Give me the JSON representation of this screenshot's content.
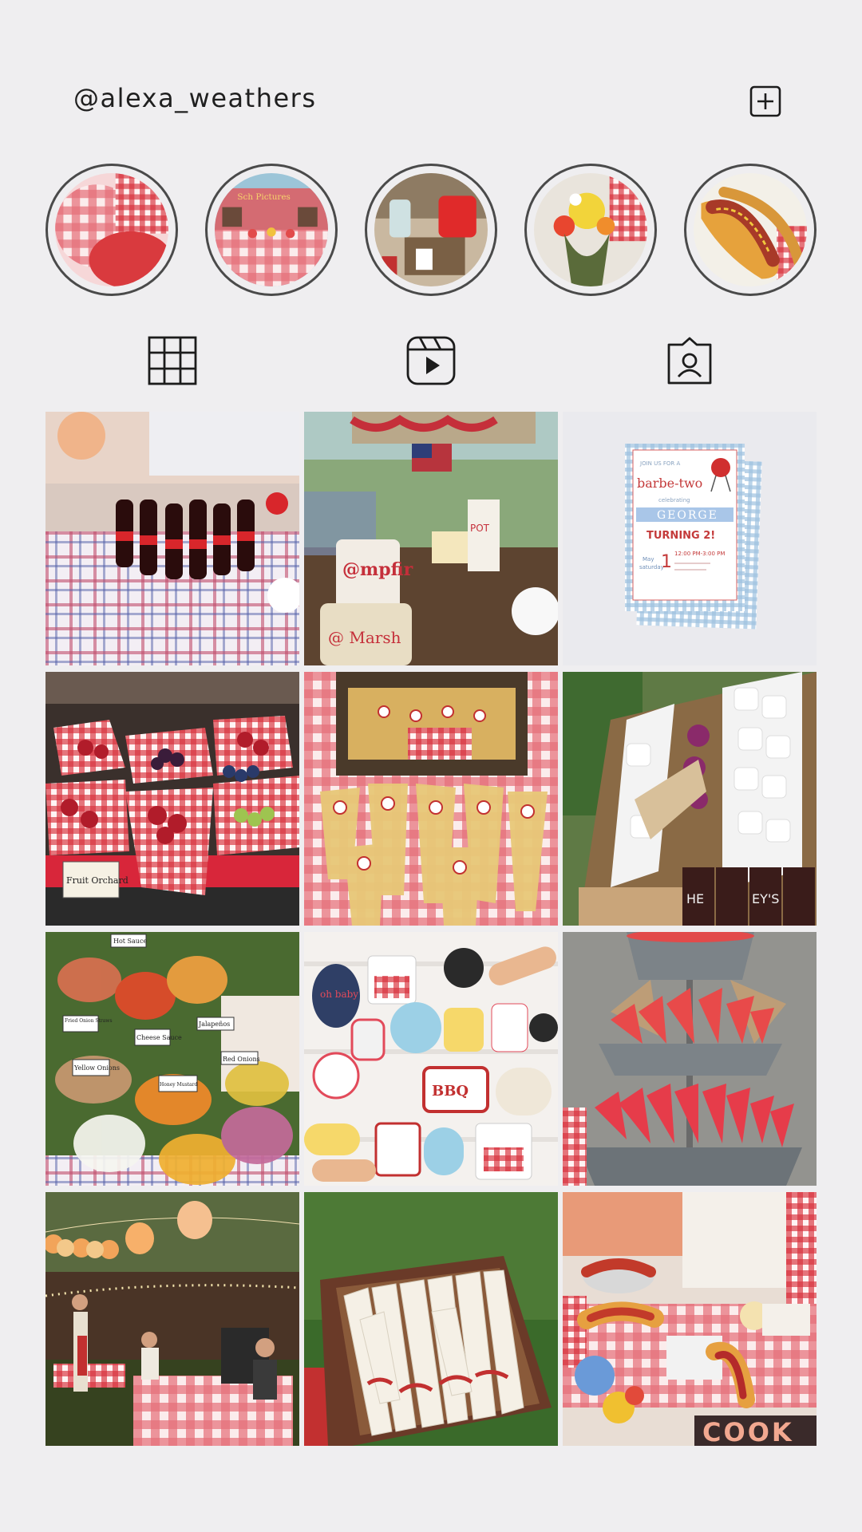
{
  "profile": {
    "username": "@alexa_weathers",
    "add_icon": "plus-square-icon"
  },
  "stories": [
    {
      "name": "story-gingham"
    },
    {
      "name": "story-picnic-house"
    },
    {
      "name": "story-drink-station"
    },
    {
      "name": "story-flowers"
    },
    {
      "name": "story-hotdog"
    }
  ],
  "tabs": [
    {
      "name": "grid-icon"
    },
    {
      "name": "reels-icon"
    },
    {
      "name": "tagged-icon"
    }
  ],
  "invitation": {
    "join": "JOIN US FOR A",
    "title": "barbe-two",
    "celebrating": "celebrating",
    "name": "GEORGE",
    "turning": "TURNING 2!",
    "time": "12:00 PM-3:00 PM",
    "day": "May",
    "weekday": "saturday"
  },
  "posts": [
    {
      "name": "post-soda-table"
    },
    {
      "name": "post-campfire-marshmallows"
    },
    {
      "name": "post-barbe-two-invitation"
    },
    {
      "name": "post-fruit-baskets",
      "label": "Fruit Orchard"
    },
    {
      "name": "post-popcorn-bags"
    },
    {
      "name": "post-smores-bar"
    },
    {
      "name": "post-condiment-bar",
      "labels": [
        "Hot Sauce",
        "Fried Onion Straws",
        "Cheese Sauce",
        "Jalapeños",
        "Yellow Onions",
        "Red Onions",
        "Honey Mustard"
      ]
    },
    {
      "name": "post-bbq-cookies",
      "labels": [
        "oh baby",
        "BBQ"
      ]
    },
    {
      "name": "post-watermelon-stand"
    },
    {
      "name": "post-backyard-lanterns"
    },
    {
      "name": "post-cutlery-basket"
    },
    {
      "name": "post-hotdog-collage",
      "label": "COOK"
    }
  ],
  "colors": {
    "background": "#efeef0",
    "icon": "#1c1c1c",
    "gingham_red": "#d8303a"
  }
}
